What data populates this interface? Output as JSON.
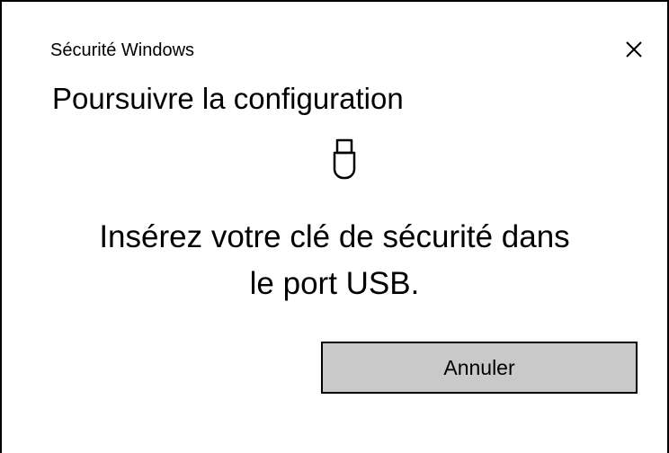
{
  "window": {
    "app_title": "Sécurité Windows",
    "close_icon": "close-icon"
  },
  "content": {
    "heading": "Poursuivre la configuration",
    "icon": "usb-key-icon",
    "message_line1": "Insérez votre clé de sécurité dans",
    "message_line2": "le port USB."
  },
  "actions": {
    "cancel_label": "Annuler"
  },
  "colors": {
    "background": "#ffffff",
    "button_background": "#c9c9c9",
    "border": "#000000",
    "text": "#000000"
  }
}
